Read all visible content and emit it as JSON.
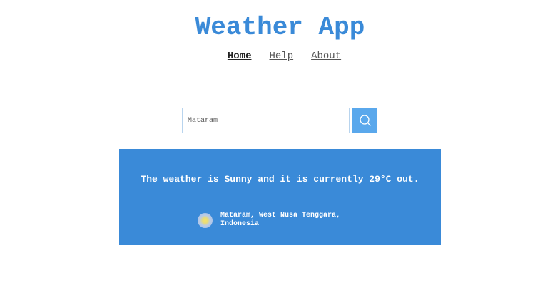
{
  "header": {
    "title": "Weather App"
  },
  "nav": {
    "items": [
      {
        "label": "Home"
      },
      {
        "label": "Help"
      },
      {
        "label": "About"
      }
    ]
  },
  "search": {
    "value": "Mataram",
    "button_icon": "search-icon"
  },
  "result": {
    "message": "The weather is Sunny and it is currently 29°C out.",
    "location": "Mataram, West Nusa Tenggara, Indonesia",
    "icon": "sunny-icon"
  },
  "colors": {
    "accent": "#3a8ad8",
    "search_button": "#5aa8ec"
  }
}
